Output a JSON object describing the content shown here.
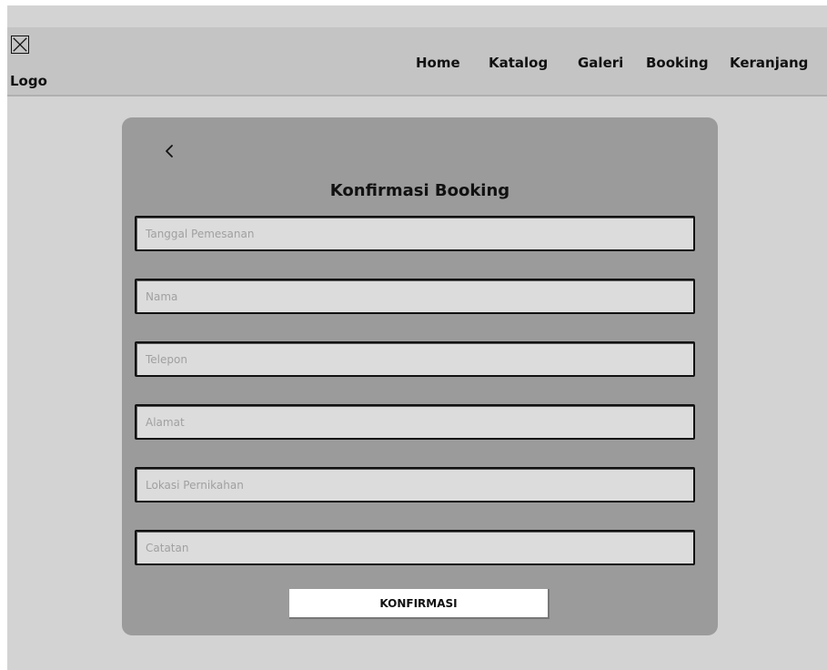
{
  "navbar": {
    "logo_label": "Logo",
    "items": [
      "Home",
      "Katalog",
      "Galeri",
      "Booking",
      "Keranjang"
    ]
  },
  "form": {
    "title": "Konfirmasi Booking",
    "fields": [
      {
        "placeholder": "Tanggal Pemesanan",
        "value": ""
      },
      {
        "placeholder": "Nama",
        "value": ""
      },
      {
        "placeholder": "Telepon",
        "value": ""
      },
      {
        "placeholder": "Alamat",
        "value": ""
      },
      {
        "placeholder": "Lokasi Pernikahan",
        "value": ""
      },
      {
        "placeholder": "Catatan",
        "value": ""
      }
    ],
    "submit_label": "KONFIRMASI"
  },
  "icons": {
    "logo": "image-placeholder-icon",
    "back": "chevron-left-icon"
  }
}
